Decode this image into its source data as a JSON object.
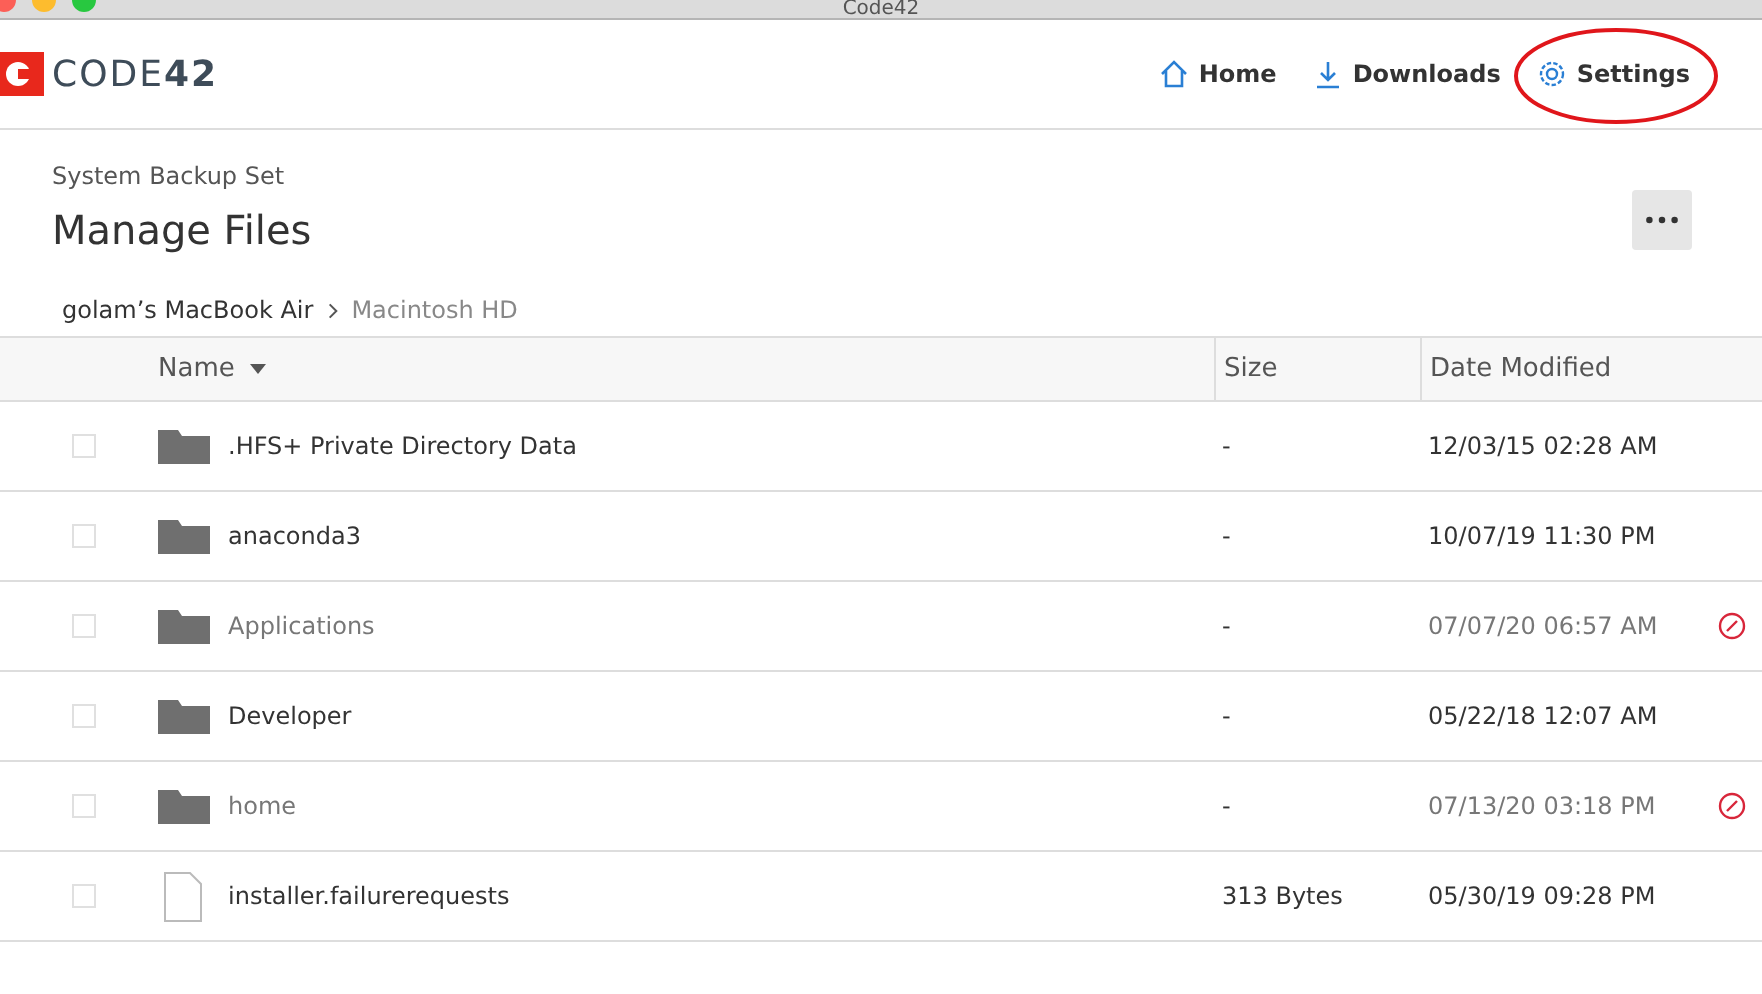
{
  "window": {
    "title": "Code42"
  },
  "brand": {
    "name": "CODE",
    "number": "42"
  },
  "nav": [
    {
      "label": "Home",
      "kind": "home",
      "highlighted": false
    },
    {
      "label": "Downloads",
      "kind": "download",
      "highlighted": false
    },
    {
      "label": "Settings",
      "kind": "settings",
      "highlighted": true
    }
  ],
  "page": {
    "subtitle": "System Backup Set",
    "title": "Manage Files"
  },
  "breadcrumb": [
    "golam’s MacBook Air",
    "Macintosh HD"
  ],
  "table": {
    "columns": [
      {
        "label": "Name",
        "sorted": true
      },
      {
        "label": "Size",
        "sorted": false
      },
      {
        "label": "Date Modified",
        "sorted": false
      }
    ],
    "rows": [
      {
        "kind": "folder",
        "name": ".HFS+ Private Directory Data",
        "size": "-",
        "date": "12/03/15 02:28 AM",
        "checked": false,
        "excluded": false
      },
      {
        "kind": "folder",
        "name": "anaconda3",
        "size": "-",
        "date": "10/07/19 11:30 PM",
        "checked": false,
        "excluded": false
      },
      {
        "kind": "folder",
        "name": "Applications",
        "size": "-",
        "date": "07/07/20 06:57 AM",
        "checked": false,
        "excluded": true
      },
      {
        "kind": "folder",
        "name": "Developer",
        "size": "-",
        "date": "05/22/18 12:07 AM",
        "checked": false,
        "excluded": false
      },
      {
        "kind": "folder",
        "name": "home",
        "size": "-",
        "date": "07/13/20 03:18 PM",
        "checked": false,
        "excluded": true
      },
      {
        "kind": "file",
        "name": "installer.failurerequests",
        "size": "313 Bytes",
        "date": "05/30/19 09:28 PM",
        "checked": false,
        "excluded": false
      }
    ]
  }
}
